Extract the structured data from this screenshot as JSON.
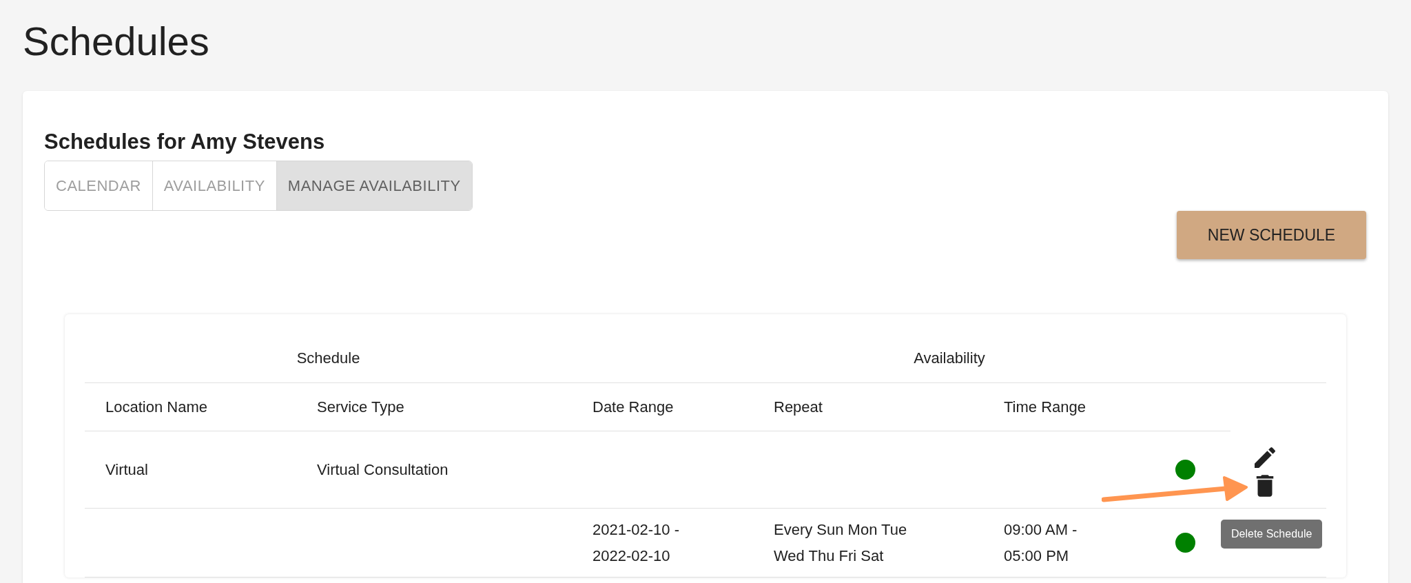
{
  "page_title": "Schedules",
  "card": {
    "title": "Schedules for Amy Stevens",
    "tabs": [
      {
        "label": "CALENDAR",
        "selected": false
      },
      {
        "label": "AVAILABILITY",
        "selected": false
      },
      {
        "label": "MANAGE AVAILABILITY",
        "selected": true
      }
    ],
    "new_button": "NEW SCHEDULE"
  },
  "table": {
    "groups": [
      {
        "label": "Schedule",
        "columns": [
          "Location Name",
          "Service Type"
        ]
      },
      {
        "label": "Availability",
        "columns": [
          "Date Range",
          "Repeat",
          "Time Range"
        ]
      }
    ],
    "rows": [
      {
        "location": "Virtual",
        "service": "Virtual Consultation",
        "color": "#008000",
        "actions": true
      },
      {
        "date_range": "2021-02-10 - 2022-02-10",
        "repeat": "Every Sun Mon Tue Wed Thu Fri Sat",
        "time_range": "09:00 AM - 05:00 PM",
        "color": "#008000",
        "actions": false
      }
    ]
  },
  "tooltip": "Delete Schedule"
}
